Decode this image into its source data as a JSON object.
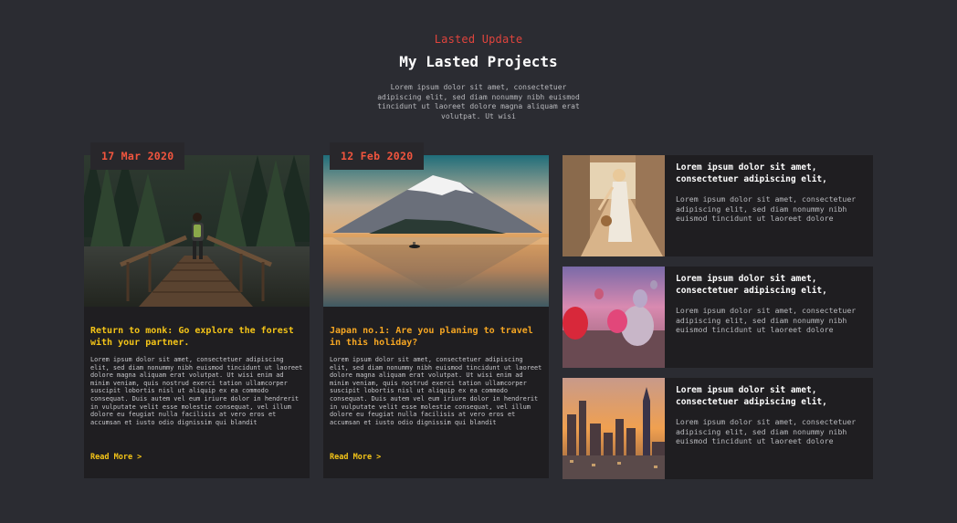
{
  "header": {
    "eyebrow": "Lasted Update",
    "title": "My Lasted Projects",
    "intro": "Lorem ipsum dolor sit amet, consectetuer adipiscing elit, sed diam nonummy nibh euismod tincidunt ut laoreet dolore magna aliquam erat volutpat. Ut wisi"
  },
  "cards": [
    {
      "date": "17 Mar 2020",
      "heading": "Return to monk: Go explore the forest with your partner.",
      "heading_color": "#f5c518",
      "body": "Lorem ipsum dolor sit amet, consectetuer adipiscing elit, sed diam nonummy nibh euismod tincidunt ut laoreet dolore magna aliquam erat volutpat. Ut wisi enim ad minim veniam, quis nostrud exerci tation ullamcorper suscipit lobortis nisl ut aliquip ex ea commodo consequat. Duis autem vel eum iriure dolor in hendrerit in vulputate velit esse molestie consequat, vel illum dolore eu feugiat nulla facilisis at vero eros et accumsan et iusto odio dignissim qui blandit",
      "read_more": "Read More >",
      "image": "forest-bridge-hiker"
    },
    {
      "date": "12 Feb 2020",
      "heading": "Japan no.1: Are you planing to travel in this holiday?",
      "heading_color": "#f5a623",
      "body": "Lorem ipsum dolor sit amet, consectetuer adipiscing elit, sed diam nonummy nibh euismod tincidunt ut laoreet dolore magna aliquam erat volutpat. Ut wisi enim ad minim veniam, quis nostrud exerci tation ullamcorper suscipit lobortis nisl ut aliquip ex ea commodo consequat. Duis autem vel eum iriure dolor in hendrerit in vulputate velit esse molestie consequat, vel illum dolore eu feugiat nulla facilisis at vero eros et accumsan et iusto odio dignissim qui blandit",
      "read_more": "Read More >",
      "image": "mount-fuji-lake"
    }
  ],
  "list": [
    {
      "title": "Lorem ipsum dolor sit amet, consectetuer adipiscing elit,",
      "body": "Lorem ipsum dolor sit amet, consectetuer adipiscing elit, sed diam nonummy nibh euismod tincidunt ut laoreet dolore",
      "image": "woman-old-town"
    },
    {
      "title": "Lorem ipsum dolor sit amet, consectetuer adipiscing elit,",
      "body": "Lorem ipsum dolor sit amet, consectetuer adipiscing elit, sed diam nonummy nibh euismod tincidunt ut laoreet dolore",
      "image": "hot-air-balloons"
    },
    {
      "title": "Lorem ipsum dolor sit amet, consectetuer adipiscing elit,",
      "body": "Lorem ipsum dolor sit amet, consectetuer adipiscing elit, sed diam nonummy nibh euismod tincidunt ut laoreet dolore",
      "image": "city-skyline-sunset"
    }
  ],
  "colors": {
    "background": "#2b2c32",
    "card": "#1f1e21",
    "accent_red": "#e0443d",
    "accent_yellow": "#f5c518"
  }
}
